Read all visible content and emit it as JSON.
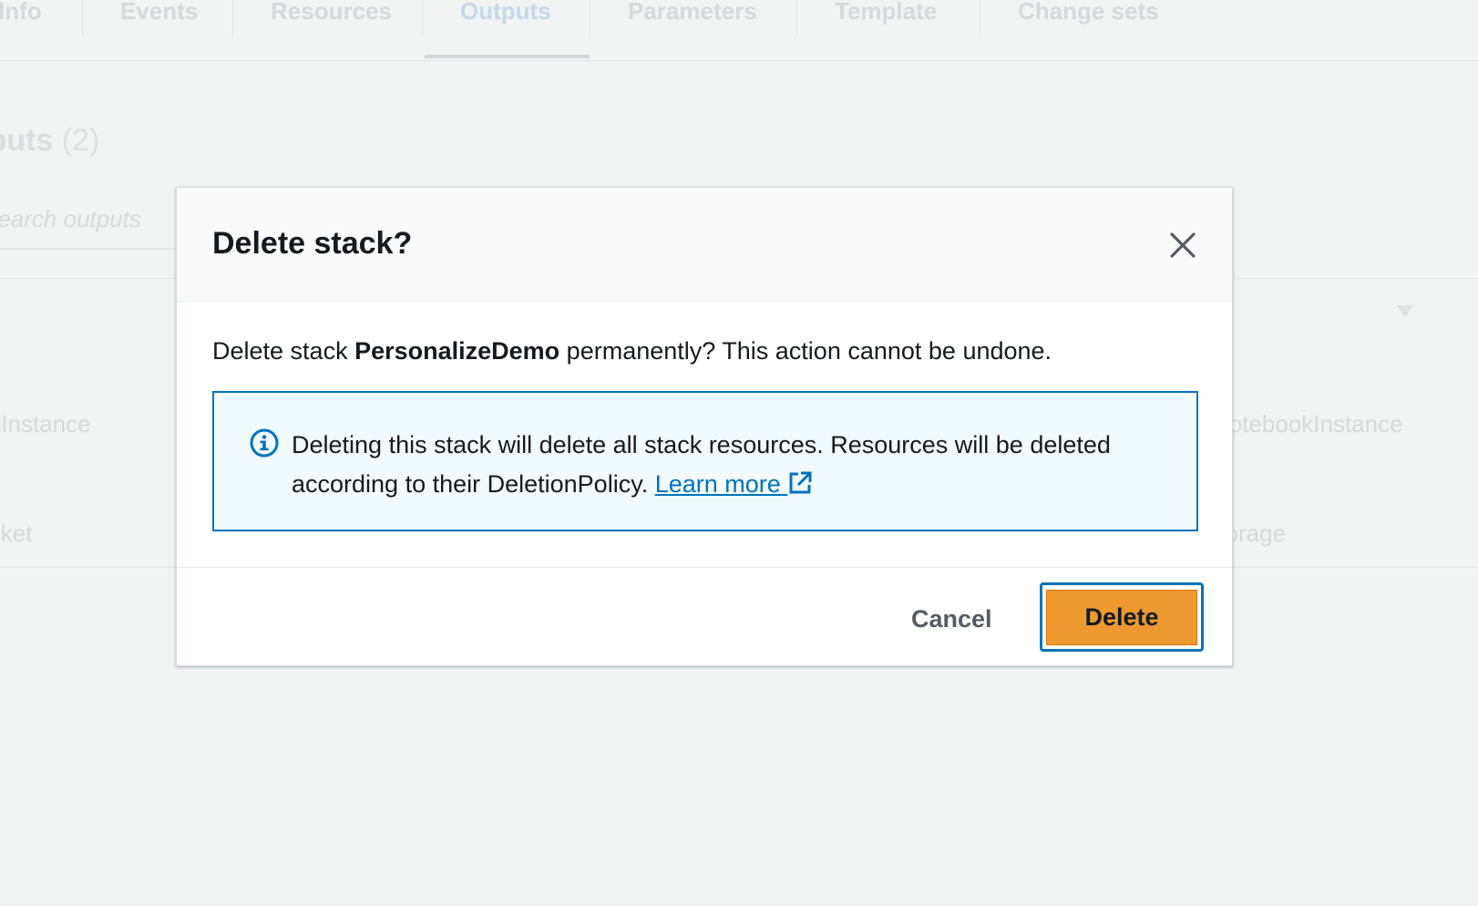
{
  "background": {
    "tabs": [
      "Info",
      "Events",
      "Resources",
      "Outputs",
      "Parameters",
      "Template",
      "Change sets"
    ],
    "active_tab": "Outputs",
    "section_title": "Outputs",
    "section_count": "(2)",
    "search_placeholder": "Search outputs",
    "rows": [
      {
        "left": "NotebookInstance",
        "right": "NotebookInstance"
      },
      {
        "left": "Bucket",
        "right": "Storage"
      }
    ]
  },
  "dialog": {
    "title": "Delete stack?",
    "body_prefix": "Delete stack ",
    "stack_name": "PersonalizeDemo",
    "body_suffix": " permanently? This action cannot be undone.",
    "alert": {
      "text": "Deleting this stack will delete all stack resources. Resources will be deleted according to their DeletionPolicy. ",
      "link_label": "Learn more ",
      "icon": "info-icon",
      "link_icon": "external-link-icon"
    },
    "cancel_label": "Cancel",
    "delete_label": "Delete",
    "close_icon": "close-icon"
  },
  "colors": {
    "primary_button": "#ec9a2f",
    "focus_ring": "#0073bb",
    "info_background": "#f1faff",
    "link": "#0073bb"
  }
}
